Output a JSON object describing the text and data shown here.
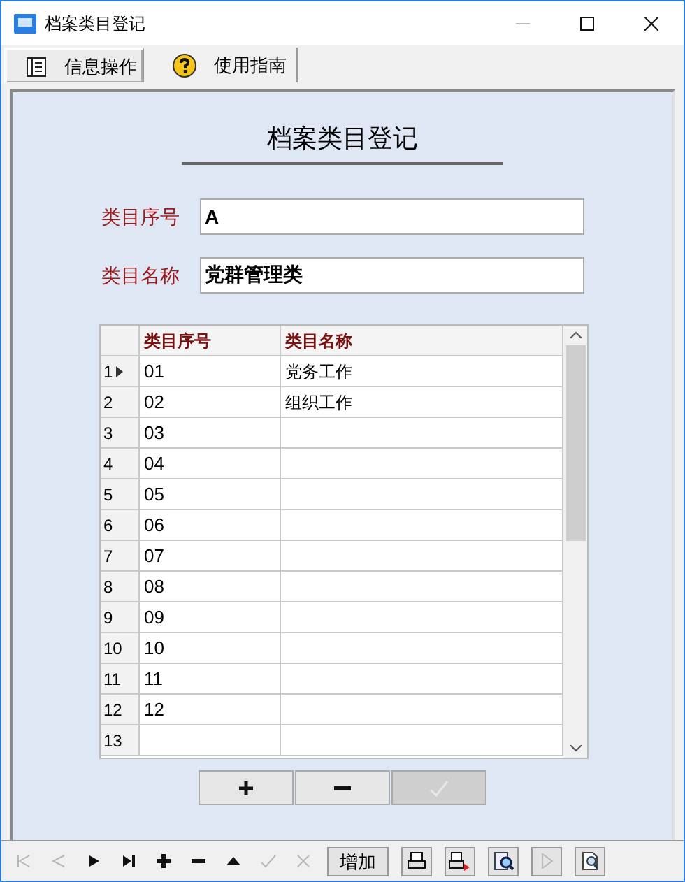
{
  "window": {
    "title": "档案类目登记"
  },
  "tabs": [
    {
      "label": "信息操作",
      "selected": true
    },
    {
      "label": "使用指南",
      "selected": false
    }
  ],
  "form": {
    "heading": "档案类目登记",
    "fields": [
      {
        "label": "类目序号",
        "value": "A"
      },
      {
        "label": "类目名称",
        "value": "党群管理类"
      }
    ]
  },
  "table": {
    "columns": [
      "类目序号",
      "类目名称"
    ],
    "rows": [
      {
        "number": "1",
        "current": true,
        "seq": "01",
        "name": "党务工作"
      },
      {
        "number": "2",
        "current": false,
        "seq": "02",
        "name": "组织工作"
      },
      {
        "number": "3",
        "current": false,
        "seq": "03"
      },
      {
        "number": "4",
        "current": false,
        "seq": "04"
      },
      {
        "number": "5",
        "current": false,
        "seq": "05"
      },
      {
        "number": "6",
        "current": false,
        "seq": "06"
      },
      {
        "number": "7",
        "current": false,
        "seq": "07"
      },
      {
        "number": "8",
        "current": false,
        "seq": "08"
      },
      {
        "number": "9",
        "current": false,
        "seq": "09"
      },
      {
        "number": "10",
        "current": false,
        "seq": "10"
      },
      {
        "number": "11",
        "current": false,
        "seq": "11"
      },
      {
        "number": "12",
        "current": false,
        "seq": "12"
      },
      {
        "number": "13",
        "current": false
      }
    ]
  },
  "grid_buttons": [
    {
      "kind": "add",
      "disabled": false
    },
    {
      "kind": "remove",
      "disabled": false
    },
    {
      "kind": "confirm",
      "disabled": true
    }
  ],
  "toolbar": [
    {
      "kind": "first",
      "disabled": true
    },
    {
      "kind": "prior",
      "disabled": true
    },
    {
      "kind": "next",
      "disabled": false
    },
    {
      "kind": "last",
      "disabled": false
    },
    {
      "kind": "insert",
      "disabled": false
    },
    {
      "kind": "delete",
      "disabled": false
    },
    {
      "kind": "edit",
      "disabled": false
    },
    {
      "kind": "post",
      "disabled": true
    },
    {
      "kind": "cancel",
      "disabled": true
    },
    {
      "kind": "text",
      "label": "增加",
      "disabled": false
    },
    {
      "kind": "print",
      "disabled": false
    },
    {
      "kind": "print-export",
      "disabled": false
    },
    {
      "kind": "preview",
      "disabled": false
    },
    {
      "kind": "play",
      "disabled": true
    },
    {
      "kind": "find",
      "disabled": false
    }
  ]
}
